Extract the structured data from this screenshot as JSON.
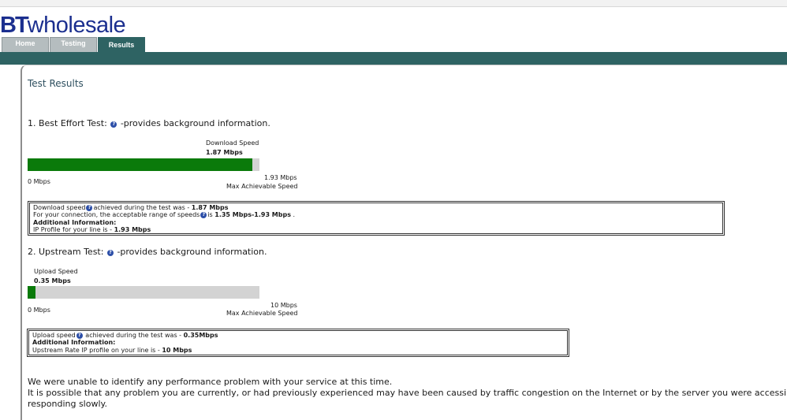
{
  "brand": {
    "bt": "BT",
    "wholesale": "wholesale"
  },
  "nav": {
    "tabs": [
      {
        "label": "Home",
        "active": false
      },
      {
        "label": "Testing",
        "active": false
      },
      {
        "label": "Results",
        "active": true
      }
    ]
  },
  "colors": {
    "brand_blue": "#1b2f8f",
    "teal": "#2e6363",
    "bar_green": "#0a7a0a",
    "bar_track": "#d3d3d3"
  },
  "page": {
    "heading": "Test Results"
  },
  "best_effort": {
    "title": "1. Best Effort Test:",
    "title_suffix": "-provides background information.",
    "speed_label": "Download Speed",
    "speed_value": "1.87 Mbps",
    "measured_mbps": 1.87,
    "max_mbps": 1.93,
    "min_label": "0 Mbps",
    "max_value": "1.93 Mbps",
    "max_label": "Max Achievable Speed",
    "info": {
      "line1_pre": "Download speed",
      "line1_mid": "achieved during the test was - ",
      "line1_val": "1.87 Mbps",
      "line2_pre": "For your connection, the acceptable range of speeds",
      "line2_mid": "is ",
      "line2_val": "1.35 Mbps-1.93 Mbps",
      "line2_end": " .",
      "additional": "Additional Information:",
      "line3_pre": "IP Profile for your line is - ",
      "line3_val": "1.93 Mbps"
    }
  },
  "upstream": {
    "title": "2. Upstream Test:",
    "title_suffix": "-provides background information.",
    "speed_label": "Upload Speed",
    "speed_value": "0.35 Mbps",
    "measured_mbps": 0.35,
    "max_mbps": 10,
    "min_label": "0 Mbps",
    "max_value": "10 Mbps",
    "max_label": "Max Achievable Speed",
    "info": {
      "line1_pre": "Upload speed",
      "line1_mid": " achieved during the test was - ",
      "line1_val": "0.35Mbps",
      "additional": "Additional Information:",
      "line2_pre": "Upstream Rate IP profile on your line is - ",
      "line2_val": "10 Mbps"
    }
  },
  "summary": {
    "line1": "We were unable to identify any performance problem with your service at this time.",
    "line2": "It is possible that any problem you are currently, or had previously experienced may have been caused by traffic congestion on the Internet or by the server you were accessing",
    "line3": "responding slowly."
  },
  "icons": {
    "help": "help-circle-icon"
  }
}
